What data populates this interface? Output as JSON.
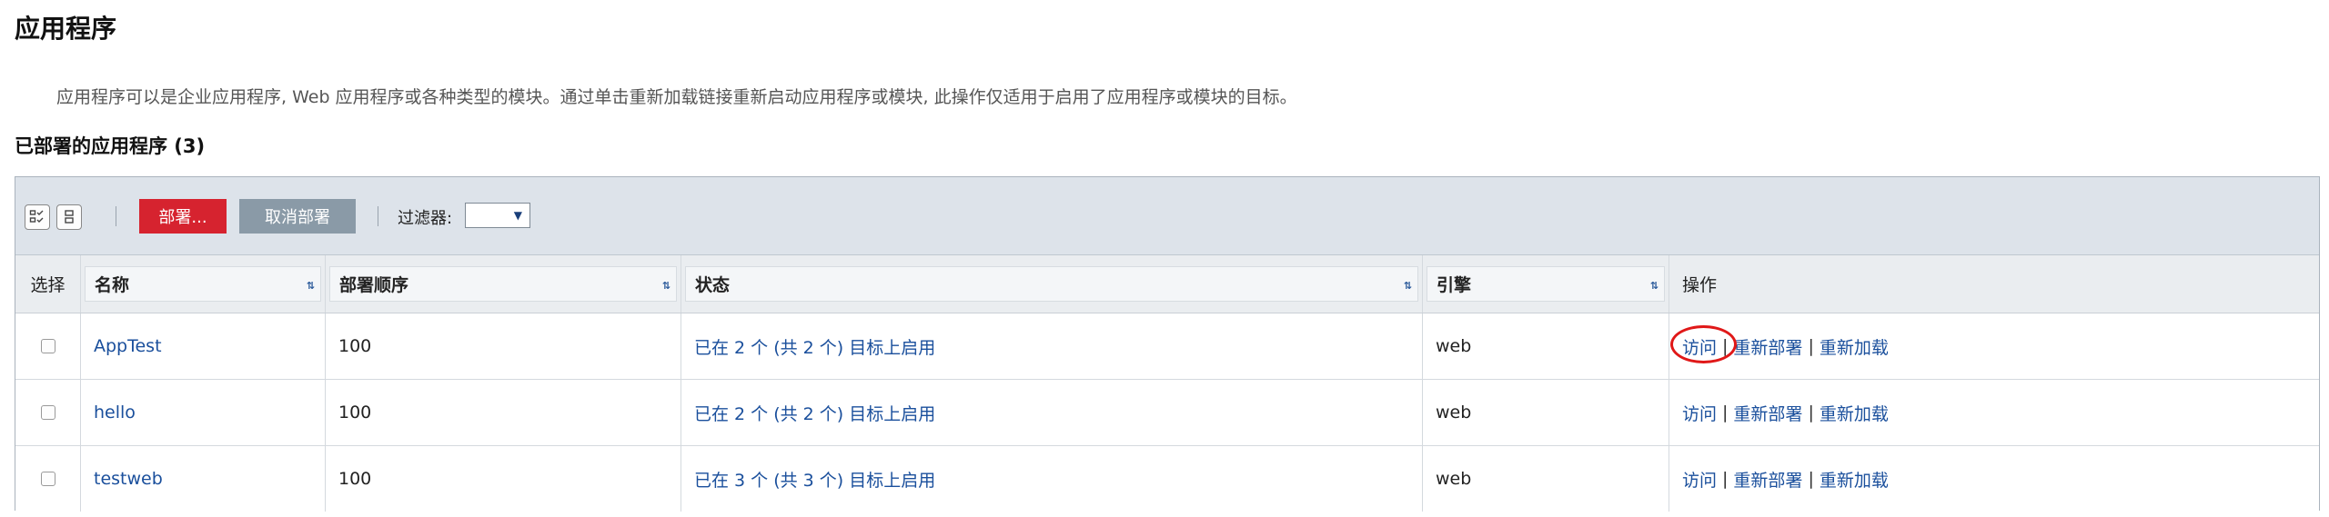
{
  "page": {
    "title": "应用程序",
    "description": "应用程序可以是企业应用程序, Web 应用程序或各种类型的模块。通过单击重新加载链接重新启动应用程序或模块, 此操作仅适用于启用了应用程序或模块的目标。",
    "section_title": "已部署的应用程序 (3)"
  },
  "toolbar": {
    "select_all_icon": "select-all-icon",
    "deselect_all_icon": "deselect-all-icon",
    "deploy_label": "部署...",
    "undeploy_label": "取消部署",
    "filter_label": "过滤器:",
    "filter_value": "",
    "colors": {
      "deploy": "#d6232f",
      "undeploy": "#8a9aa7",
      "toolbar_bg": "#dde3ea"
    }
  },
  "table": {
    "headers": {
      "select": "选择",
      "name": "名称",
      "order": "部署顺序",
      "status": "状态",
      "engine": "引擎",
      "ops": "操作"
    },
    "rows": [
      {
        "name": "AppTest",
        "order": "100",
        "status": "已在 2 个 (共 2 个) 目标上启用",
        "engine": "web",
        "ops": {
          "visit": "访问",
          "redeploy": "重新部署",
          "reload": "重新加载",
          "sep": "|"
        }
      },
      {
        "name": "hello",
        "order": "100",
        "status": "已在 2 个 (共 2 个) 目标上启用",
        "engine": "web",
        "ops": {
          "visit": "访问",
          "redeploy": "重新部署",
          "reload": "重新加载",
          "sep": "|"
        }
      },
      {
        "name": "testweb",
        "order": "100",
        "status": "已在 3 个 (共 3 个) 目标上启用",
        "engine": "web",
        "ops": {
          "visit": "访问",
          "redeploy": "重新部署",
          "reload": "重新加载",
          "sep": "|"
        }
      }
    ],
    "link_color": "#1a4f9c",
    "annotation_color": "#e01818"
  }
}
